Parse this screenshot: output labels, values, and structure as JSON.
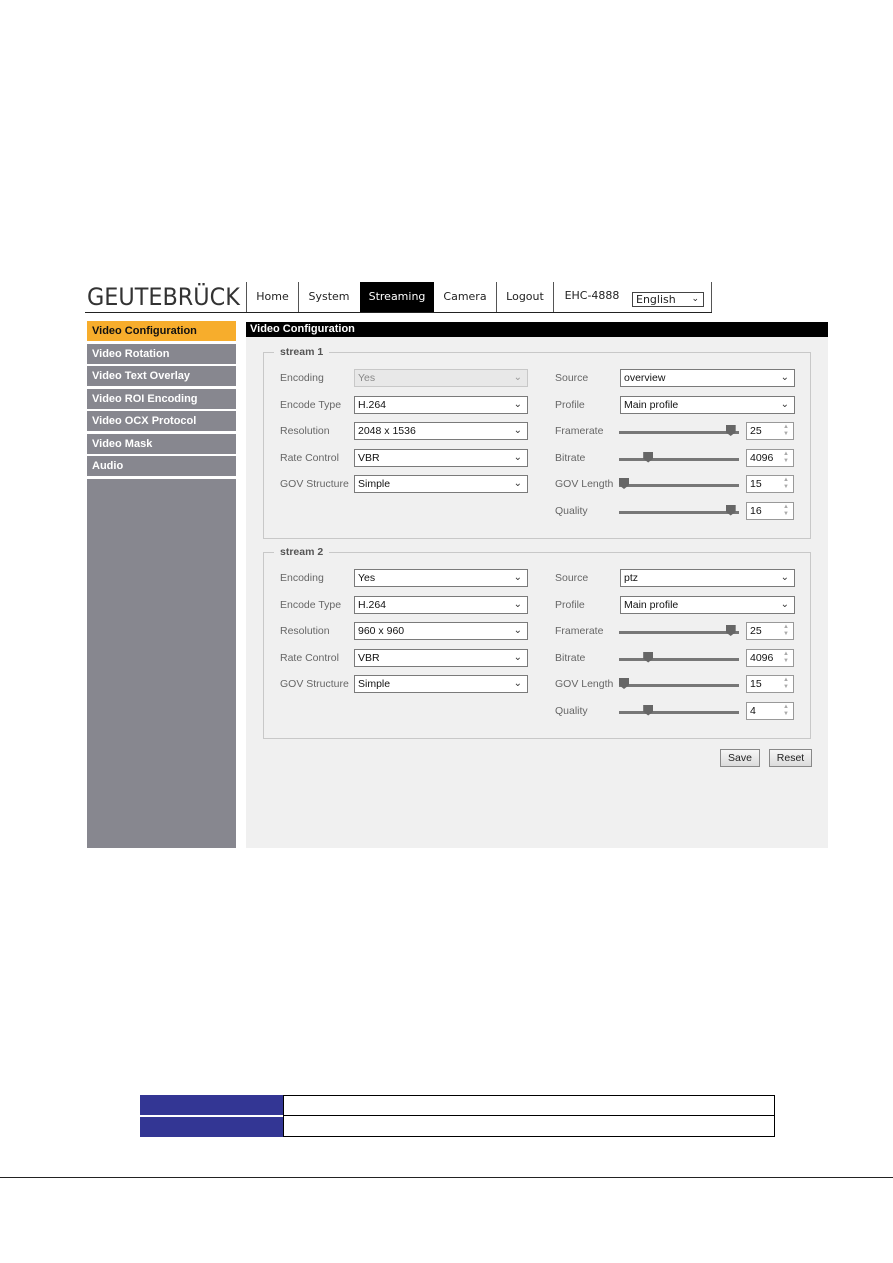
{
  "header": {
    "logo": "GEUTEBRÜCK",
    "nav": [
      {
        "label": "Home",
        "active": false
      },
      {
        "label": "System",
        "active": false
      },
      {
        "label": "Streaming",
        "active": true
      },
      {
        "label": "Camera",
        "active": false
      },
      {
        "label": "Logout",
        "active": false
      }
    ],
    "device_model": "EHC-4888",
    "language": "English"
  },
  "sidebar": {
    "items": [
      {
        "label": "Video Configuration",
        "active": true
      },
      {
        "label": "Video Rotation",
        "active": false
      },
      {
        "label": "Video Text Overlay",
        "active": false
      },
      {
        "label": "Video ROI Encoding",
        "active": false
      },
      {
        "label": "Video OCX Protocol",
        "active": false
      },
      {
        "label": "Video Mask",
        "active": false
      },
      {
        "label": "Audio",
        "active": false
      }
    ]
  },
  "main": {
    "title": "Video Configuration",
    "labels": {
      "encoding": "Encoding",
      "encode_type": "Encode Type",
      "resolution": "Resolution",
      "rate_control": "Rate Control",
      "gov_structure": "GOV Structure",
      "source": "Source",
      "profile": "Profile",
      "framerate": "Framerate",
      "bitrate": "Bitrate",
      "gov_length": "GOV Length",
      "quality": "Quality"
    },
    "streams": [
      {
        "title": "stream 1",
        "encoding": "Yes",
        "encoding_disabled": true,
        "encode_type": "H.264",
        "resolution": "2048 x 1536",
        "rate_control": "VBR",
        "gov_structure": "Simple",
        "source": "overview",
        "profile": "Main profile",
        "framerate": {
          "value": "25",
          "slider_fraction": 0.97
        },
        "bitrate": {
          "value": "4096",
          "slider_fraction": 0.22
        },
        "gov_length": {
          "value": "15",
          "slider_fraction": 0.0
        },
        "quality": {
          "value": "16",
          "slider_fraction": 0.97
        }
      },
      {
        "title": "stream 2",
        "encoding": "Yes",
        "encoding_disabled": false,
        "encode_type": "H.264",
        "resolution": "960 x 960",
        "rate_control": "VBR",
        "gov_structure": "Simple",
        "source": "ptz",
        "profile": "Main profile",
        "framerate": {
          "value": "25",
          "slider_fraction": 0.97
        },
        "bitrate": {
          "value": "4096",
          "slider_fraction": 0.22
        },
        "gov_length": {
          "value": "15",
          "slider_fraction": 0.0
        },
        "quality": {
          "value": "4",
          "slider_fraction": 0.22
        }
      }
    ],
    "buttons": {
      "save": "Save",
      "reset": "Reset"
    }
  },
  "icons": {
    "chevron": "⌄",
    "spin_up": "▲",
    "spin_down": "▼"
  },
  "colors": {
    "active_tab": "#000000",
    "sidebar_active": "#f7ad2c",
    "sidebar_item": "#87878f",
    "panel_bg": "#f0f0f0",
    "table_header": "#333694"
  }
}
